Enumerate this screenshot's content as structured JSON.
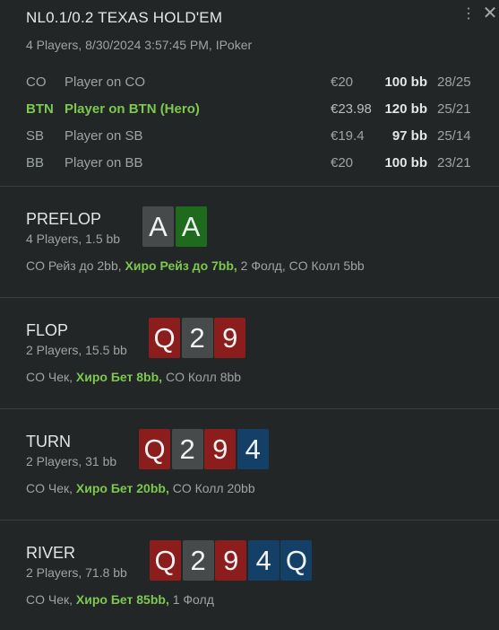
{
  "header": {
    "title": "NL0.1/0.2 TEXAS HOLD'EM",
    "subtitle": "4 Players, 8/30/2024 3:57:45 PM, IPoker",
    "menu_icon": "⋮",
    "close_icon": "✕"
  },
  "players": [
    {
      "pos": "CO",
      "name": "Player on CO",
      "stack": "€20",
      "bb": "100 bb",
      "ratio": "28/25",
      "hero": false
    },
    {
      "pos": "BTN",
      "name": "Player on BTN (Hero)",
      "stack": "€23.98",
      "bb": "120 bb",
      "ratio": "25/21",
      "hero": true
    },
    {
      "pos": "SB",
      "name": "Player on SB",
      "stack": "€19.4",
      "bb": "97 bb",
      "ratio": "25/14",
      "hero": false
    },
    {
      "pos": "BB",
      "name": "Player on BB",
      "stack": "€20",
      "bb": "100 bb",
      "ratio": "23/21",
      "hero": false
    }
  ],
  "streets": [
    {
      "name": "PREFLOP",
      "info": "4 Players, 1.5 bb",
      "cards": [
        {
          "rank": "A",
          "suit": "s"
        },
        {
          "rank": "A",
          "suit": "c"
        }
      ],
      "action_pre": "CO Рейз до 2bb, ",
      "action_hero": "Хиро Рейз до 7bb,",
      "action_post": " 2 Фолд, CO Колл 5bb"
    },
    {
      "name": "FLOP",
      "info": "2 Players, 15.5 bb",
      "cards": [
        {
          "rank": "Q",
          "suit": "h"
        },
        {
          "rank": "2",
          "suit": "s"
        },
        {
          "rank": "9",
          "suit": "h"
        }
      ],
      "action_pre": "CO Чек, ",
      "action_hero": "Хиро Бет 8bb,",
      "action_post": " CO Колл 8bb"
    },
    {
      "name": "TURN",
      "info": "2 Players, 31 bb",
      "cards": [
        {
          "rank": "Q",
          "suit": "h"
        },
        {
          "rank": "2",
          "suit": "s"
        },
        {
          "rank": "9",
          "suit": "h"
        },
        {
          "rank": "4",
          "suit": "d"
        }
      ],
      "action_pre": "CO Чек, ",
      "action_hero": "Хиро Бет 20bb,",
      "action_post": " CO Колл 20bb"
    },
    {
      "name": "RIVER",
      "info": "2 Players, 71.8 bb",
      "cards": [
        {
          "rank": "Q",
          "suit": "h"
        },
        {
          "rank": "2",
          "suit": "s"
        },
        {
          "rank": "9",
          "suit": "h"
        },
        {
          "rank": "4",
          "suit": "d"
        },
        {
          "rank": "Q",
          "suit": "d"
        }
      ],
      "action_pre": "CO Чек, ",
      "action_hero": "Хиро Бет 85bb,",
      "action_post": " 1 Фолд"
    }
  ],
  "colors": {
    "hero": "#7dc84e",
    "heart": "#8b1d1d",
    "spade": "#474a4a",
    "club": "#1e6b1e",
    "diamond": "#144068"
  }
}
